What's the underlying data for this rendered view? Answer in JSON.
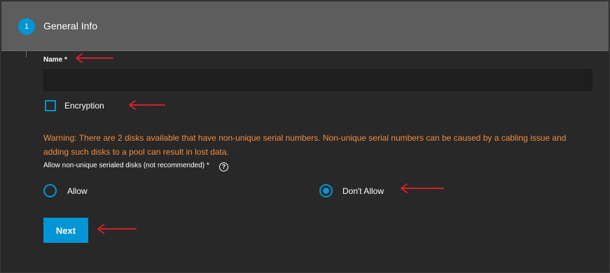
{
  "step": {
    "number": "1",
    "title": "General Info"
  },
  "name_field": {
    "label": "Name *",
    "value": "",
    "placeholder": ""
  },
  "encryption": {
    "label": "Encryption",
    "checked": false
  },
  "warning_text": "Warning: There are 2 disks available that have non-unique serial numbers. Non-unique serial numbers can be caused by a cabling issue and adding such disks to a pool can result in lost data.",
  "serial_option": {
    "label": "Allow non-unique serialed disks (not recommended) *",
    "help_icon": "help-circle-icon",
    "options": [
      {
        "label": "Allow",
        "selected": false
      },
      {
        "label": "Don't Allow",
        "selected": true
      }
    ]
  },
  "next_button": {
    "label": "Next"
  },
  "colors": {
    "accent": "#0095d5",
    "warning": "#f08c3c",
    "annotation_arrow": "#d0202e",
    "header_bg": "#5d5d5d",
    "panel_bg": "#282828"
  }
}
